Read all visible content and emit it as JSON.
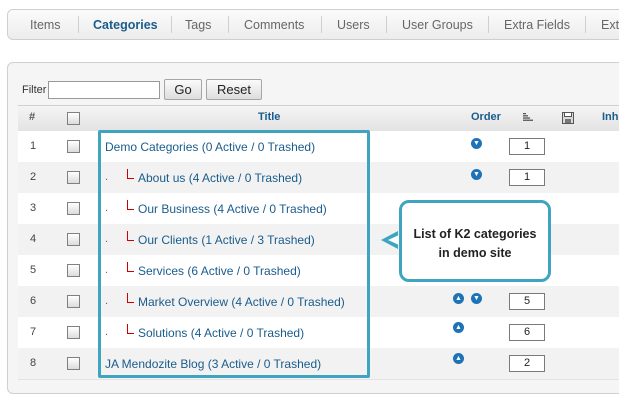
{
  "tabs": [
    "Items",
    "Categories",
    "Tags",
    "Comments",
    "Users",
    "User Groups",
    "Extra Fields",
    "Ext"
  ],
  "active_tab": "Categories",
  "filter": {
    "label": "Filter",
    "value": "",
    "go_label": "Go",
    "reset_label": "Reset"
  },
  "table": {
    "headers": {
      "num": "#",
      "title": "Title",
      "order": "Order",
      "inherit": "Inh"
    },
    "rows": [
      {
        "num": "1",
        "indent": 0,
        "title": "Demo Categories (0 Active / 0 Trashed)",
        "up": false,
        "down": true,
        "order": "1"
      },
      {
        "num": "2",
        "indent": 1,
        "title": "About us (4 Active / 0 Trashed)",
        "up": false,
        "down": true,
        "order": "1"
      },
      {
        "num": "3",
        "indent": 1,
        "title": "Our Business (4 Active / 0 Trashed)",
        "up": false,
        "down": false,
        "order": ""
      },
      {
        "num": "4",
        "indent": 1,
        "title": "Our Clients (1 Active / 3 Trashed)",
        "up": false,
        "down": false,
        "order": ""
      },
      {
        "num": "5",
        "indent": 1,
        "title": "Services (6 Active / 0 Trashed)",
        "up": false,
        "down": false,
        "order": ""
      },
      {
        "num": "6",
        "indent": 1,
        "title": "Market Overview (4 Active / 0 Trashed)",
        "up": true,
        "down": true,
        "order": "5"
      },
      {
        "num": "7",
        "indent": 1,
        "title": "Solutions (4 Active / 0 Trashed)",
        "up": true,
        "down": false,
        "order": "6"
      },
      {
        "num": "8",
        "indent": 0,
        "title": "JA Mendozite Blog (3 Active / 0 Trashed)",
        "up": true,
        "down": false,
        "order": "2"
      }
    ]
  },
  "callout": {
    "line1": "List of K2 categories",
    "line2": "in demo site"
  },
  "colors": {
    "link": "#1a5c8c",
    "accent": "#3ea4c0",
    "order_icon": "#1e73b8",
    "tree_mark": "#cc0000"
  }
}
